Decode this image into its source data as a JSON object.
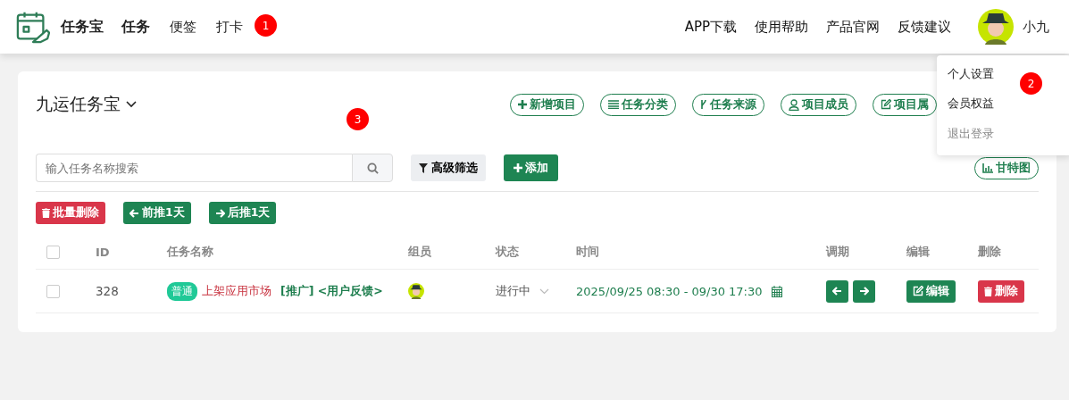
{
  "header": {
    "logo_text": "任务宝",
    "nav": [
      {
        "label": "任务",
        "selected": true
      },
      {
        "label": "便签",
        "selected": false
      },
      {
        "label": "打卡",
        "selected": false
      }
    ],
    "links": [
      "APP下载",
      "使用帮助",
      "产品官网",
      "反馈建议"
    ],
    "user": "小九"
  },
  "user_menu": [
    {
      "label": "个人设置",
      "muted": false
    },
    {
      "label": "会员权益",
      "muted": false
    },
    {
      "label": "退出登录",
      "muted": true
    }
  ],
  "markers": [
    {
      "label": "1",
      "kind": "nav"
    },
    {
      "label": "2",
      "kind": "menu"
    },
    {
      "label": "3",
      "kind": "card"
    }
  ],
  "project": {
    "title": "九运任务宝",
    "actions": [
      {
        "label": "新增项目",
        "kind": "plus"
      },
      {
        "label": "任务分类",
        "kind": "list"
      },
      {
        "label": "任务来源",
        "kind": "branch"
      },
      {
        "label": "项目成员",
        "kind": "user"
      },
      {
        "label": "项目属",
        "kind": "edit"
      }
    ]
  },
  "search": {
    "placeholder": "输入任务名称搜索"
  },
  "filter_button": "高级筛选",
  "add_button": "添加",
  "gantt_button": "甘特图",
  "bulk_buttons": [
    {
      "label": "批量删除",
      "kind": "trash"
    },
    {
      "label": "前推1天",
      "kind": "left"
    },
    {
      "label": "后推1天",
      "kind": "right"
    }
  ],
  "table": {
    "select_all": {
      "checked": false
    },
    "columns": [
      "ID",
      "任务名称",
      "组员",
      "状态",
      "时间",
      "调期",
      "编辑",
      "删除"
    ],
    "rows": [
      {
        "checked": false,
        "id": "328",
        "tag": {
          "label": "普通",
          "color": "#20c997"
        },
        "name": "上架应用市场",
        "extra": "[推广] <用户反馈>",
        "status": "进行中",
        "time": "2025/09/25 08:30 - 09/30 17:30",
        "edit": "编辑",
        "delete": "删除"
      }
    ]
  }
}
